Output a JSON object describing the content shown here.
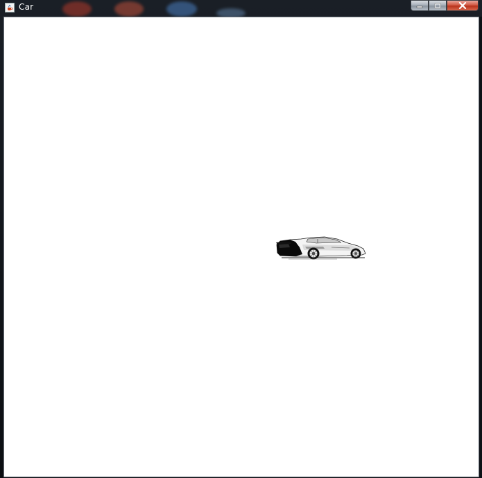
{
  "window": {
    "title": "Car",
    "title_icon": "java-cup-icon",
    "controls": {
      "minimize_icon": "minimize-icon",
      "maximize_icon": "maximize-icon",
      "close_icon": "close-icon"
    }
  },
  "canvas": {
    "background": "#ffffff",
    "sprite": "sports-car-image"
  },
  "colors": {
    "close_button": "#c8412a",
    "frame": "#0e1318"
  }
}
